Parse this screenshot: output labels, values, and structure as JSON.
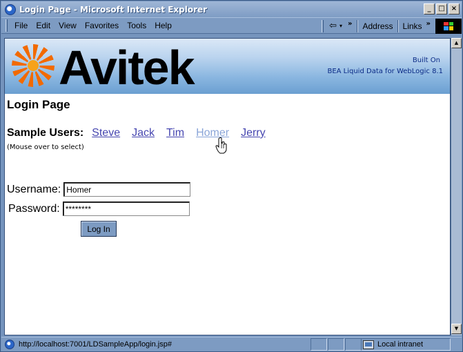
{
  "window": {
    "title": "Login Page - Microsoft Internet Explorer",
    "buttons": {
      "minimize": "_",
      "maximize": "□",
      "close": "×"
    }
  },
  "menu": {
    "items": [
      "File",
      "Edit",
      "View",
      "Favorites",
      "Tools",
      "Help"
    ],
    "back_glyph": "⇦",
    "dropdown_glyph": "▾",
    "chevron": "»",
    "address_label": "Address",
    "links_label": "Links"
  },
  "banner": {
    "logo_text": "Avitek",
    "built_on": "Built On",
    "platform": "BEA Liquid Data for WebLogic 8.1"
  },
  "page": {
    "title": "Login Page",
    "sample_users_label": "Sample Users:",
    "sample_users": [
      "Steve",
      "Jack",
      "Tim",
      "Homer",
      "Jerry"
    ],
    "hovered_user": "Homer",
    "mouse_hint": "(Mouse over to select)"
  },
  "form": {
    "username_label": "Username:",
    "username_value": "Homer",
    "password_label": "Password:",
    "password_value": "********",
    "login_label": "Log In"
  },
  "status": {
    "url": "http://localhost:7001/LDSampleApp/login.jsp#",
    "zone": "Local intranet"
  },
  "colors": {
    "chrome": "#7d9bc2",
    "link": "#4646b0",
    "link_hover": "#8aa5d8",
    "logo_orange": "#f26a00"
  }
}
